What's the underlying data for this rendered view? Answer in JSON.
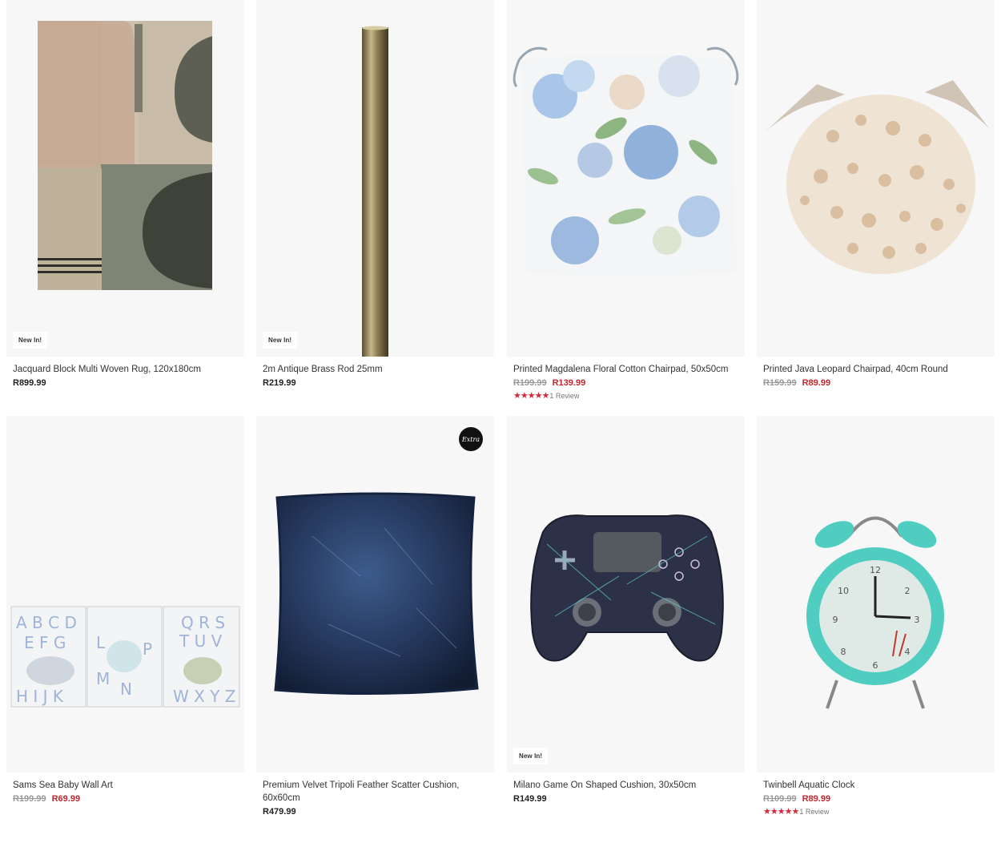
{
  "products": [
    {
      "title": "Jacquard Block Multi Woven Rug, 120x180cm",
      "badge": "New In!",
      "price": "R899.99"
    },
    {
      "title": "2m Antique Brass Rod 25mm",
      "badge": "New In!",
      "price": "R219.99"
    },
    {
      "title": "Printed Magdalena Floral Cotton Chairpad, 50x50cm",
      "was_price": "R199.99",
      "sale_price": "R139.99",
      "stars": "★★★★★",
      "reviews": "1 Review"
    },
    {
      "title": "Printed Java Leopard Chairpad, 40cm Round",
      "was_price": "R159.99",
      "sale_price": "R89.99"
    },
    {
      "title": "Sams Sea Baby Wall Art",
      "was_price": "R199.99",
      "sale_price": "R69.99"
    },
    {
      "title": "Premium Velvet Tripoli Feather Scatter Cushion, 60x60cm",
      "badge_extra": "Extra",
      "price": "R479.99"
    },
    {
      "title": "Milano Game On Shaped Cushion, 30x50cm",
      "badge": "New In!",
      "price": "R149.99"
    },
    {
      "title": "Twinbell Aquatic Clock",
      "was_price": "R109.99",
      "sale_price": "R89.99",
      "stars": "★★★★★",
      "reviews": "1 Review"
    }
  ],
  "colors": {
    "sale": "#c0282d",
    "star": "#d42b3a",
    "card_bg": "#f7f7f7"
  }
}
